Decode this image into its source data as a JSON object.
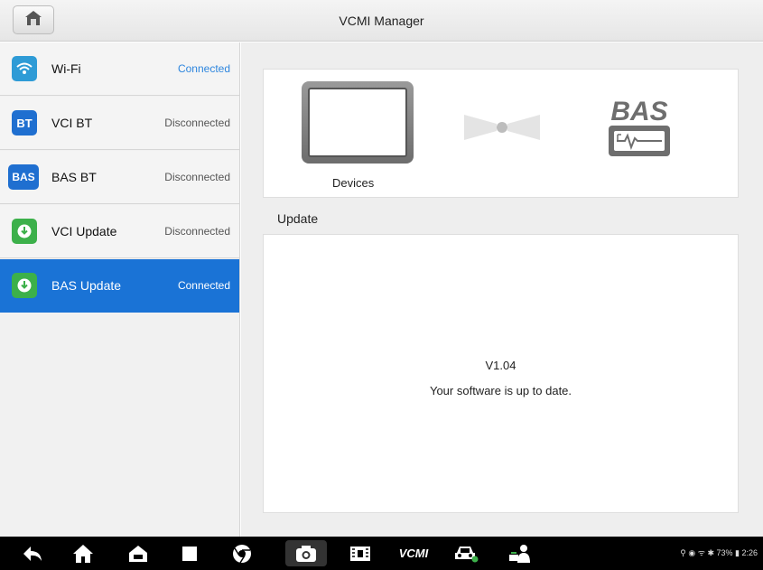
{
  "header": {
    "title": "VCMI Manager"
  },
  "sidebar": {
    "items": [
      {
        "icon": "wifi-icon",
        "label": "Wi-Fi",
        "status": "Connected",
        "active": false
      },
      {
        "icon_text": "BT",
        "label": "VCI BT",
        "status": "Disconnected",
        "active": false
      },
      {
        "icon_text": "BAS",
        "label": "BAS BT",
        "status": "Disconnected",
        "active": false
      },
      {
        "icon": "download-icon",
        "label": "VCI Update",
        "status": "Disconnected",
        "active": false
      },
      {
        "icon": "download-icon",
        "label": "BAS Update",
        "status": "Connected",
        "active": true
      }
    ]
  },
  "main": {
    "devices_label": "Devices",
    "bas_logo_text": "BAS",
    "update_heading": "Update",
    "version": "V1.04",
    "status_message": "Your software is up to date."
  },
  "navbar": {
    "vcmi_label": "VCMI",
    "status_text": "⚲ ◉ ᯤ ✱ 73% ▮ 2:26"
  },
  "colors": {
    "accent": "#1a73d6",
    "connected_text": "#2e86de",
    "wifi_icon_bg": "#2e9bd6",
    "bt_icon_bg": "#1f6fd0",
    "update_icon_bg": "#3cb04a"
  }
}
